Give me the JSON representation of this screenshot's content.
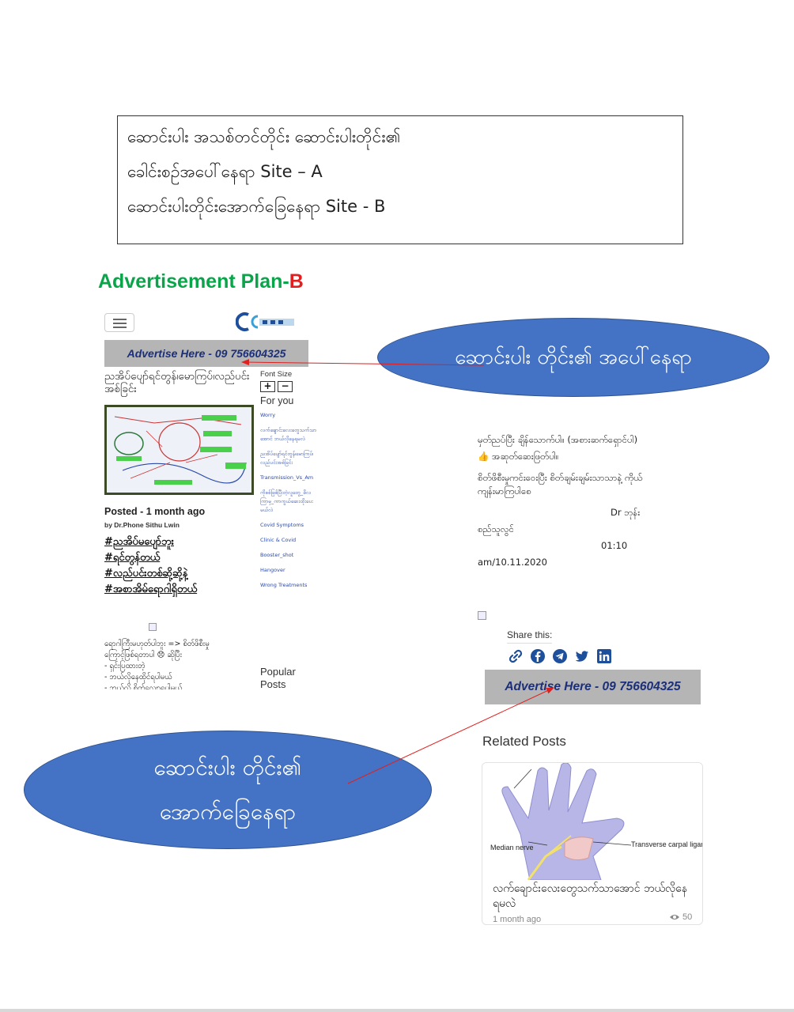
{
  "intro": {
    "lines": [
      "ဆောင်းပါး အသစ်တင်တိုင်း ဆောင်းပါးတိုင်း၏",
      " ခေါင်းစဥ်အပေါ်နေရာ Site – A",
      "ဆောင်းပါးတိုင်းအောက်ခြေနေရာ Site - B"
    ]
  },
  "plan_title": {
    "main": "Advertisement Plan-",
    "suffix": "B"
  },
  "left_screenshot": {
    "ad_banner": "Advertise Here - 09 756604325",
    "article_title": "ညအိပ်ပျော်ရင်တွန်၊မောကြပ်၊လည်ပင်းအစ်ခြင်း",
    "posted": "Posted - 1 month ago",
    "byline": "by Dr.Phone Sithu Lwin",
    "hashtags": [
      "#ညအိပ်မပျော်ဘူး",
      "#ရင်တွန်တယ်",
      "#လည်ပင်းတစ်ဆို့ဆို့နဲ့",
      "#အစာအိမ်ရောဂါရှိတယ်"
    ],
    "body": [
      "ရောဂါကြီးမဟုတ်ပါဘူး => စိတ်ဖိစီးမှု",
      "ကြောင့်ဖြစ်ရတာပါ 😞 ဆိုပြီး",
      "- ရှင်းပြထားတဲ့",
      "- ဘယ်လိုနေထိုင်ရပါမယ်",
      "- ဘယ်လို စိတ်လျှော့ရပါမယ်"
    ],
    "sidebar": {
      "font_size_label": "Font Size",
      "plus": "+",
      "minus": "−",
      "for_you": "For you",
      "links": [
        "Worry",
        "လက်ချောင်းလေးတွေသက်သာအောင် ဘယ်လိုနေရမလဲ",
        "ညအိပ်ပျော်ရင်တွန်၊မောကြပ်၊လည်ပင်းအစ်ခြင်း",
        "Transmission_Vs_Am",
        "ကိုစစ်ဖြစ်ပြီးတဲ့လူတွေ_ဖိလကြာမှ_ကာကွယ်ဆေးထိုးပေးမယ်လဲ",
        "Covid Symptoms",
        "Clinic & Covid",
        "Booster_shot",
        "Hangover",
        "Wrong Treatments"
      ],
      "popular_posts": "Popular Posts"
    }
  },
  "callouts": {
    "top": [
      "ဆောင်းပါး တိုင်း၏ အပေါ်နေရာ"
    ],
    "bottom": [
      "ဆောင်းပါး တိုင်း၏",
      "အောက်ခြေနေရာ"
    ]
  },
  "right_screenshot": {
    "paragraphs": [
      "မှတ်ညပ်ပြီး ချိန်သောက်ပါ။ (အစားဆက်ရှောင်ပါ)",
      "👍 အဆုတ်ဆေးဖြတ်ပါ။",
      "စိတ်ဖိစီးမှုကင်းဝေးပြီး စိတ်ချမ်းချမ်းသာသာနဲ့ ကိုယ်ကျန်းမာကြပါစေ"
    ],
    "signature": "Dr ဘုန်း",
    "signature_2": "စည်သူလွင်",
    "time": "01:10",
    "date": "am/10.11.2020",
    "share_label": "Share this:",
    "share_icons": [
      "link-icon",
      "facebook-icon",
      "telegram-icon",
      "twitter-icon",
      "linkedin-icon"
    ],
    "ad_banner": "Advertise Here - 09 756604325",
    "related_heading": "Related Posts",
    "related_card": {
      "title": "လက်ချောင်းလေးတွေသက်သာအောင် ဘယ်လိုနေရမလဲ",
      "date": "1 month ago",
      "views": "50",
      "image_label_1": "Median nerve",
      "image_label_2": "Transverse carpal ligament"
    }
  },
  "colors": {
    "callout_fill": "#4472c4",
    "plan_title_green": "#0aa54a",
    "plan_title_red": "#e02020",
    "ad_banner_bg": "#b5b5b5",
    "ad_banner_text": "#1b2f7a",
    "arrow": "#e02020"
  }
}
